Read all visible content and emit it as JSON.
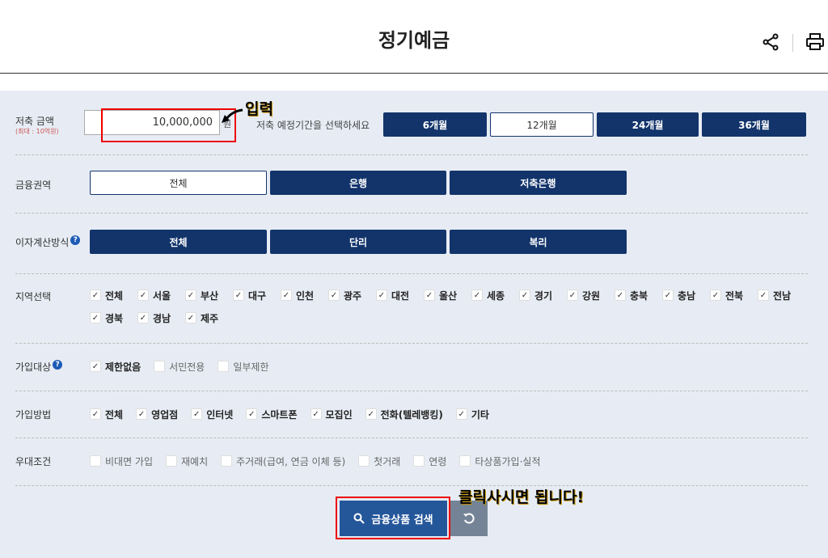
{
  "header": {
    "title": "정기예금",
    "icons": [
      "share-icon",
      "print-icon"
    ]
  },
  "amount": {
    "label": "저축 금액",
    "sub": "(최대 : 10억원)",
    "value": "10,000,000",
    "unit": "원"
  },
  "period": {
    "hint": "저축 예정기간을 선택하세요",
    "options": [
      "6개월",
      "12개월",
      "24개월",
      "36개월"
    ],
    "selected": "12개월"
  },
  "sector": {
    "label": "금융권역",
    "options": [
      "전체",
      "은행",
      "저축은행"
    ],
    "selected": "전체"
  },
  "interest": {
    "label": "이자계산방식",
    "help": "?",
    "options": [
      "전체",
      "단리",
      "복리"
    ]
  },
  "region": {
    "label": "지역선택",
    "items": [
      {
        "t": "전체",
        "c": true
      },
      {
        "t": "서울",
        "c": true
      },
      {
        "t": "부산",
        "c": true
      },
      {
        "t": "대구",
        "c": true
      },
      {
        "t": "인천",
        "c": true
      },
      {
        "t": "광주",
        "c": true
      },
      {
        "t": "대전",
        "c": true
      },
      {
        "t": "울산",
        "c": true
      },
      {
        "t": "세종",
        "c": true
      },
      {
        "t": "경기",
        "c": true
      },
      {
        "t": "강원",
        "c": true
      },
      {
        "t": "충북",
        "c": true
      },
      {
        "t": "충남",
        "c": true
      },
      {
        "t": "전북",
        "c": true
      },
      {
        "t": "전남",
        "c": true
      },
      {
        "t": "경북",
        "c": true
      },
      {
        "t": "경남",
        "c": true
      },
      {
        "t": "제주",
        "c": true
      }
    ]
  },
  "target": {
    "label": "가입대상",
    "help": "?",
    "items": [
      {
        "t": "제한없음",
        "c": true
      },
      {
        "t": "서민전용",
        "c": false
      },
      {
        "t": "일부제한",
        "c": false
      }
    ]
  },
  "method": {
    "label": "가입방법",
    "items": [
      {
        "t": "전체",
        "c": true
      },
      {
        "t": "영업점",
        "c": true
      },
      {
        "t": "인터넷",
        "c": true
      },
      {
        "t": "스마트폰",
        "c": true
      },
      {
        "t": "모집인",
        "c": true
      },
      {
        "t": "전화(텔레뱅킹)",
        "c": true
      },
      {
        "t": "기타",
        "c": true
      }
    ]
  },
  "benefit": {
    "label": "우대조건",
    "items": [
      {
        "t": "비대면 가입",
        "c": false
      },
      {
        "t": "재예치",
        "c": false
      },
      {
        "t": "주거래(급여, 연금 이체 등)",
        "c": false
      },
      {
        "t": "첫거래",
        "c": false
      },
      {
        "t": "연령",
        "c": false
      },
      {
        "t": "타상품가입·실적",
        "c": false
      }
    ]
  },
  "actions": {
    "search": "금융상품 검색",
    "reset_icon": "reset-icon"
  },
  "annotations": {
    "input_note": "입력",
    "click_note": "클릭사시면 됩니다!"
  },
  "colors": {
    "primary": "#12346b",
    "search": "#24569a",
    "panel": "#e7ecf4",
    "highlight": "#e00000"
  }
}
